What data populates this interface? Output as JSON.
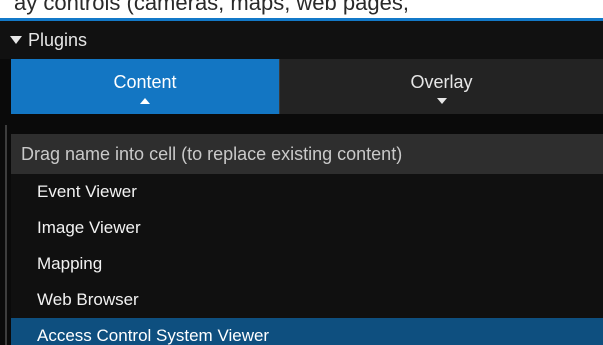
{
  "top_strip": {
    "text": "ay controls (cameras, maps, web pages,"
  },
  "plugins_section": {
    "title": "Plugins",
    "tabs": [
      {
        "label": "Content",
        "active": true
      },
      {
        "label": "Overlay",
        "active": false
      }
    ],
    "hint": "Drag name into cell (to replace existing content)",
    "items": [
      {
        "label": "Event Viewer",
        "selected": false
      },
      {
        "label": "Image Viewer",
        "selected": false
      },
      {
        "label": "Mapping",
        "selected": false
      },
      {
        "label": "Web Browser",
        "selected": false
      },
      {
        "label": "Access Control System Viewer",
        "selected": true
      }
    ]
  },
  "colors": {
    "accent": "#1376c3",
    "selected_row": "#0e4f7f",
    "background": "#0a0a0a",
    "hint_bar": "#2e2e2e"
  },
  "icons": {
    "section_toggle": "caret-down-icon",
    "active_tab_indicator": "arrow-up-icon",
    "inactive_tab_indicator": "arrow-down-icon"
  }
}
